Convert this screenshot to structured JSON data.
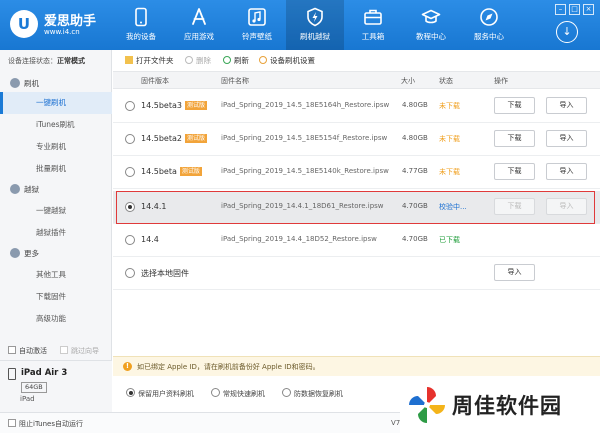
{
  "app": {
    "title": "爱思助手",
    "url": "www.i4.cn",
    "logo_letter": "U"
  },
  "nav": [
    {
      "label": "我的设备",
      "icon": "phone-icon"
    },
    {
      "label": "应用游戏",
      "icon": "app-store-icon"
    },
    {
      "label": "铃声壁纸",
      "icon": "music-icon"
    },
    {
      "label": "刷机越狱",
      "icon": "flash-icon"
    },
    {
      "label": "工具箱",
      "icon": "toolbox-icon"
    },
    {
      "label": "教程中心",
      "icon": "graduation-cap-icon"
    },
    {
      "label": "服务中心",
      "icon": "compass-icon"
    }
  ],
  "sidebar": {
    "conn_label": "设备连接状态：",
    "conn_mode": "正常模式",
    "flash_group": "刷机",
    "flash_items": [
      "一键刷机",
      "iTunes刷机",
      "专业刷机",
      "批量刷机"
    ],
    "jailbreak_group": "越狱",
    "jailbreak_items": [
      "一键越狱",
      "越狱插件"
    ],
    "more_group": "更多",
    "more_items": [
      "其他工具",
      "下载固件",
      "高级功能"
    ],
    "auto_activate": "自动激活",
    "skip_guide": "跳过向导"
  },
  "device": {
    "name": "iPad Air 3",
    "capacity": "64GB",
    "type": "iPad"
  },
  "toolbar": {
    "open_folder": "打开文件夹",
    "delete": "删除",
    "refresh": "刷新",
    "settings": "设备刷机设置"
  },
  "table": {
    "headers": {
      "version": "固件版本",
      "name": "固件名称",
      "size": "大小",
      "status": "状态",
      "action": "操作"
    },
    "download_label": "下载",
    "import_label": "导入",
    "beta_badge": "测试版",
    "rows": [
      {
        "version": "14.5beta3",
        "beta": true,
        "file": "iPad_Spring_2019_14.5_18E5164h_Restore.ipsw",
        "size": "4.80GB",
        "status": "未下载",
        "status_color": "#f0a020"
      },
      {
        "version": "14.5beta2",
        "beta": true,
        "file": "iPad_Spring_2019_14.5_18E5154f_Restore.ipsw",
        "size": "4.80GB",
        "status": "未下载",
        "status_color": "#f0a020"
      },
      {
        "version": "14.5beta",
        "beta": true,
        "file": "iPad_Spring_2019_14.5_18E5140k_Restore.ipsw",
        "size": "4.77GB",
        "status": "未下载",
        "status_color": "#f0a020"
      },
      {
        "version": "14.4.1",
        "beta": false,
        "file": "iPad_Spring_2019_14.4.1_18D61_Restore.ipsw",
        "size": "4.70GB",
        "status": "校验中...",
        "status_color": "#1a6fd1"
      },
      {
        "version": "14.4",
        "beta": false,
        "file": "iPad_Spring_2019_14.4_18D52_Restore.ipsw",
        "size": "4.70GB",
        "status": "已下载",
        "status_color": "#1f9d3a"
      }
    ],
    "local_firmware": "选择本地固件"
  },
  "notice": {
    "text": "如已绑定 Apple ID，请在刷机前备份好 Apple ID和密码。"
  },
  "options": [
    "保留用户资料刷机",
    "常规快速刷机",
    "防数据恢复刷机"
  ],
  "footer": {
    "block_itunes": "阻止iTunes自动运行",
    "version": "V7"
  },
  "watermark": {
    "text": "周佳软件园"
  },
  "colors": {
    "header": "#1a7ad6",
    "highlight": "#e03a3a",
    "beta_badge": "#f2a43a"
  }
}
